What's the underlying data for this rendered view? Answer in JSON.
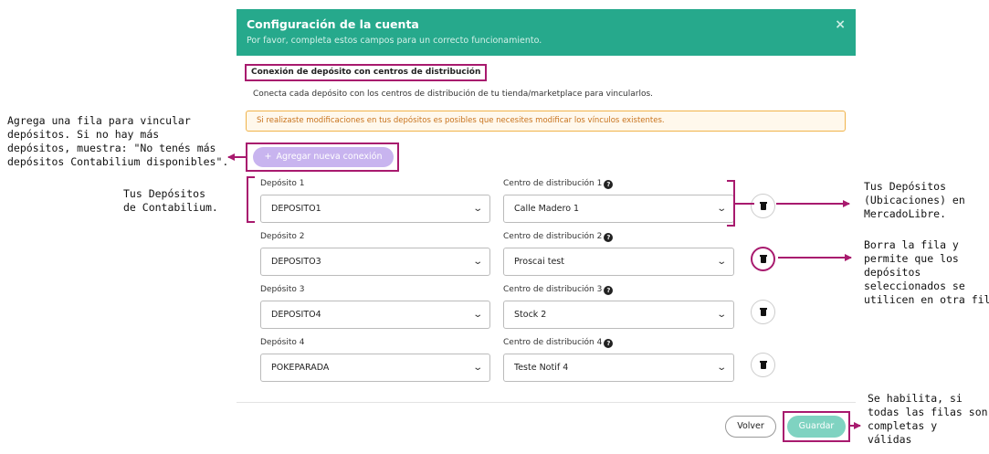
{
  "modal": {
    "title": "Configuración de la cuenta",
    "subtitle": "Por favor, completa estos campos para un correcto funcionamiento.",
    "close_label": "×",
    "section_title": "Conexión de depósito con centros de distribución",
    "section_desc": "Conecta cada depósito con los centros de distribución de tu tienda/marketplace para vincularlos.",
    "warning": "Si realizaste modificaciones en tus depósitos es posibles que necesites modificar los vínculos existentes.",
    "add_button": {
      "icon": "+",
      "label": "Agregar nueva conexión"
    },
    "help_icon": "?",
    "rows": [
      {
        "deposit_label": "Depósito 1",
        "deposit_value": "DEPOSITO1",
        "center_label": "Centro de distribución 1",
        "center_value": "Calle Madero 1"
      },
      {
        "deposit_label": "Depósito 2",
        "deposit_value": "DEPOSITO3",
        "center_label": "Centro de distribución 2",
        "center_value": "Proscai test"
      },
      {
        "deposit_label": "Depósito 3",
        "deposit_value": "DEPOSITO4",
        "center_label": "Centro de distribución 3",
        "center_value": "Stock 2"
      },
      {
        "deposit_label": "Depósito 4",
        "deposit_value": "POKEPARADA",
        "center_label": "Centro de distribución 4",
        "center_value": "Teste Notif 4"
      }
    ],
    "back_button": "Volver",
    "save_button": "Guardar"
  },
  "annotations": {
    "add_row": [
      "Agrega una fila para vincular",
      "depósitos. Si no hay más",
      "depósitos, muestra: \"No tenés más",
      "depósitos Contabilium disponibles\"."
    ],
    "my_deposits": [
      "Tus Depósitos",
      "de Contabilium."
    ],
    "ml_deposits": [
      "Tus Depósitos",
      "(Ubicaciones) en",
      "MercadoLibre."
    ],
    "delete_row": [
      "Borra la fila y",
      "permite que los",
      "depósitos",
      "seleccionados se",
      "utilicen en otra fila."
    ],
    "save_enabled": [
      "Se habilita, si",
      "todas las filas son",
      "completas y",
      "válidas"
    ]
  },
  "colors": {
    "header": "#26a98c",
    "annotation": "#a81a6e",
    "add_button": "#c8b4ef",
    "save_button": "#7fd3c1",
    "warning_border": "#f0b34a",
    "warning_text": "#c8731d"
  }
}
